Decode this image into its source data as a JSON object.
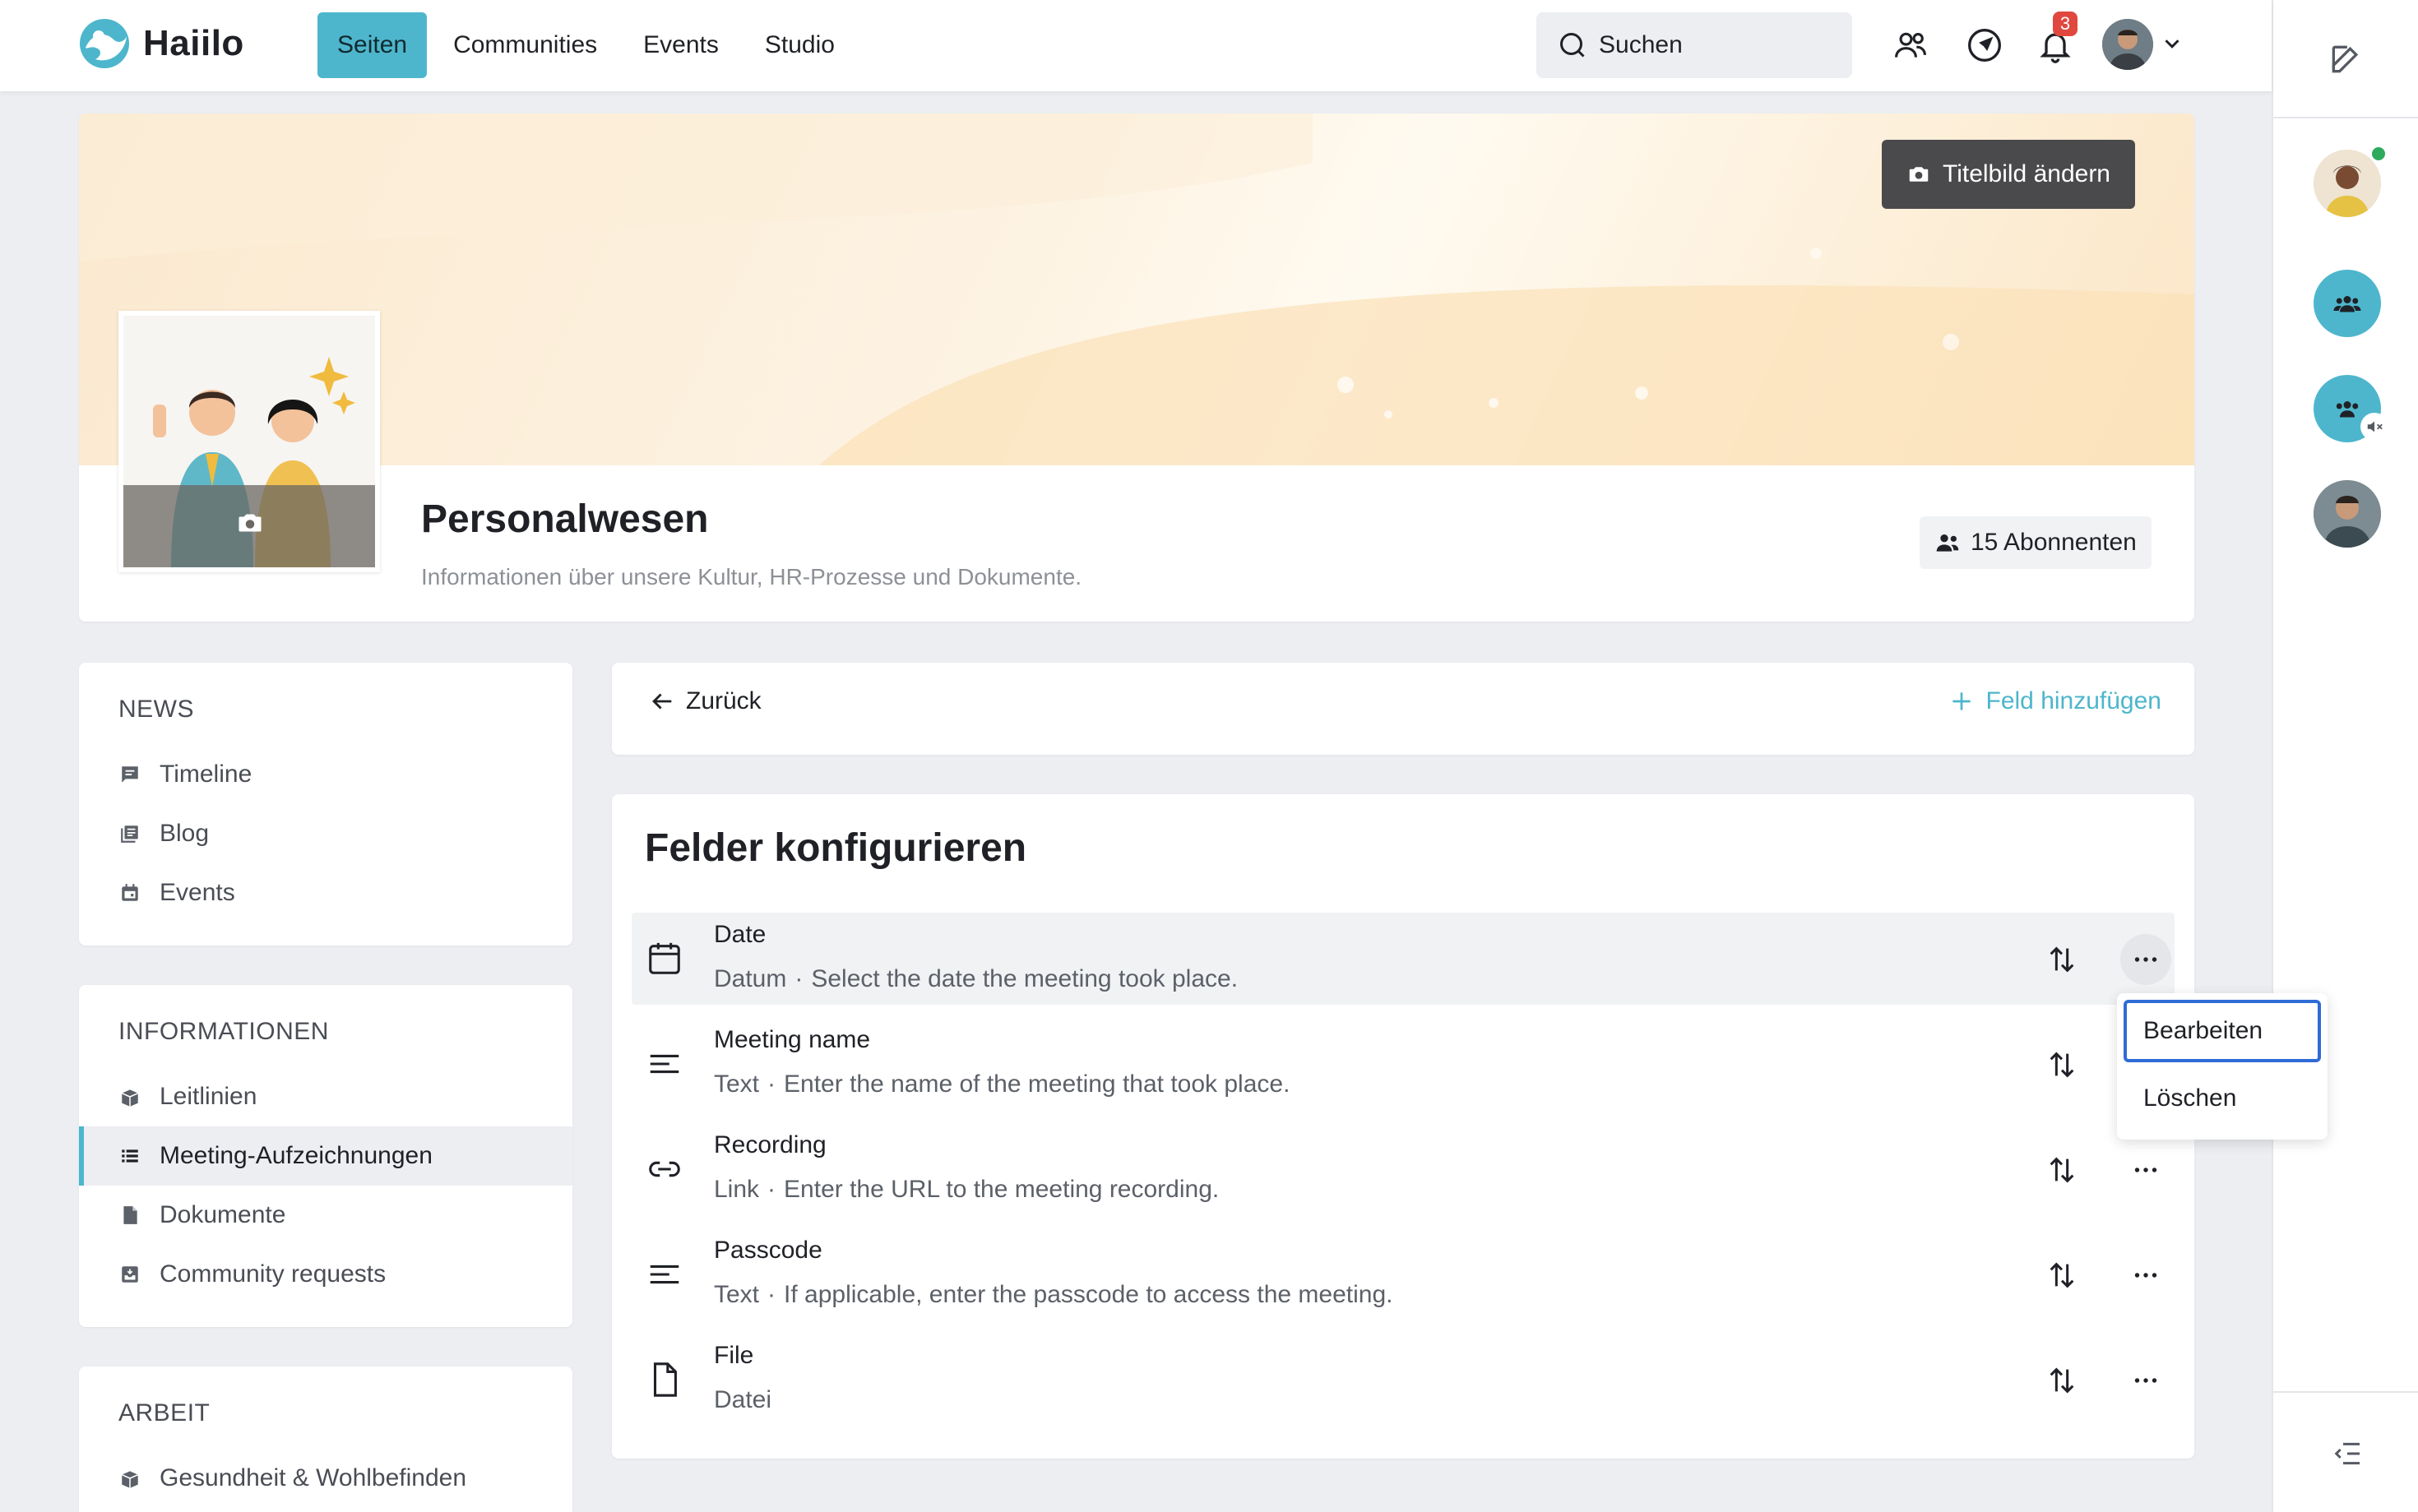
{
  "app": {
    "brand": "Haiilo",
    "nav": [
      {
        "label": "Seiten",
        "active": true
      },
      {
        "label": "Communities",
        "active": false
      },
      {
        "label": "Events",
        "active": false
      },
      {
        "label": "Studio",
        "active": false
      }
    ],
    "search_placeholder": "Suchen",
    "notification_count": "3",
    "accent_color": "#4db6cc"
  },
  "page": {
    "cover_button": "Titelbild ändern",
    "title": "Personalwesen",
    "subtitle": "Informationen über unsere Kultur, HR-Prozesse und Dokumente.",
    "subscribers": "15 Abonnenten"
  },
  "sidebar": {
    "sections": [
      {
        "heading": "NEWS",
        "items": [
          {
            "label": "Timeline",
            "icon": "timeline-icon"
          },
          {
            "label": "Blog",
            "icon": "blog-icon"
          },
          {
            "label": "Events",
            "icon": "calendar-icon"
          }
        ]
      },
      {
        "heading": "INFORMATIONEN",
        "items": [
          {
            "label": "Leitlinien",
            "icon": "box-icon"
          },
          {
            "label": "Meeting-Aufzeichnungen",
            "icon": "list-icon",
            "active": true
          },
          {
            "label": "Dokumente",
            "icon": "document-icon"
          },
          {
            "label": "Community requests",
            "icon": "inbox-icon"
          }
        ]
      },
      {
        "heading": "ARBEIT",
        "items": [
          {
            "label": "Gesundheit & Wohlbefinden",
            "icon": "box-icon"
          }
        ]
      }
    ]
  },
  "toolbar": {
    "back_label": "Zurück",
    "add_field_label": "Feld hinzufügen"
  },
  "fields": {
    "title": "Felder konfigurieren",
    "rows": [
      {
        "name": "Date",
        "type": "Datum",
        "desc": "Select the date the meeting took place.",
        "icon": "calendar-icon"
      },
      {
        "name": "Meeting name",
        "type": "Text",
        "desc": "Enter the name of the meeting that took place.",
        "icon": "text-icon"
      },
      {
        "name": "Recording",
        "type": "Link",
        "desc": "Enter the URL to the meeting recording.",
        "icon": "link-icon"
      },
      {
        "name": "Passcode",
        "type": "Text",
        "desc": "If applicable, enter the passcode to access the meeting.",
        "icon": "text-icon"
      },
      {
        "name": "File",
        "type": "Datei",
        "desc": "",
        "icon": "file-icon"
      }
    ]
  },
  "context_menu": {
    "items": [
      "Bearbeiten",
      "Löschen"
    ]
  }
}
